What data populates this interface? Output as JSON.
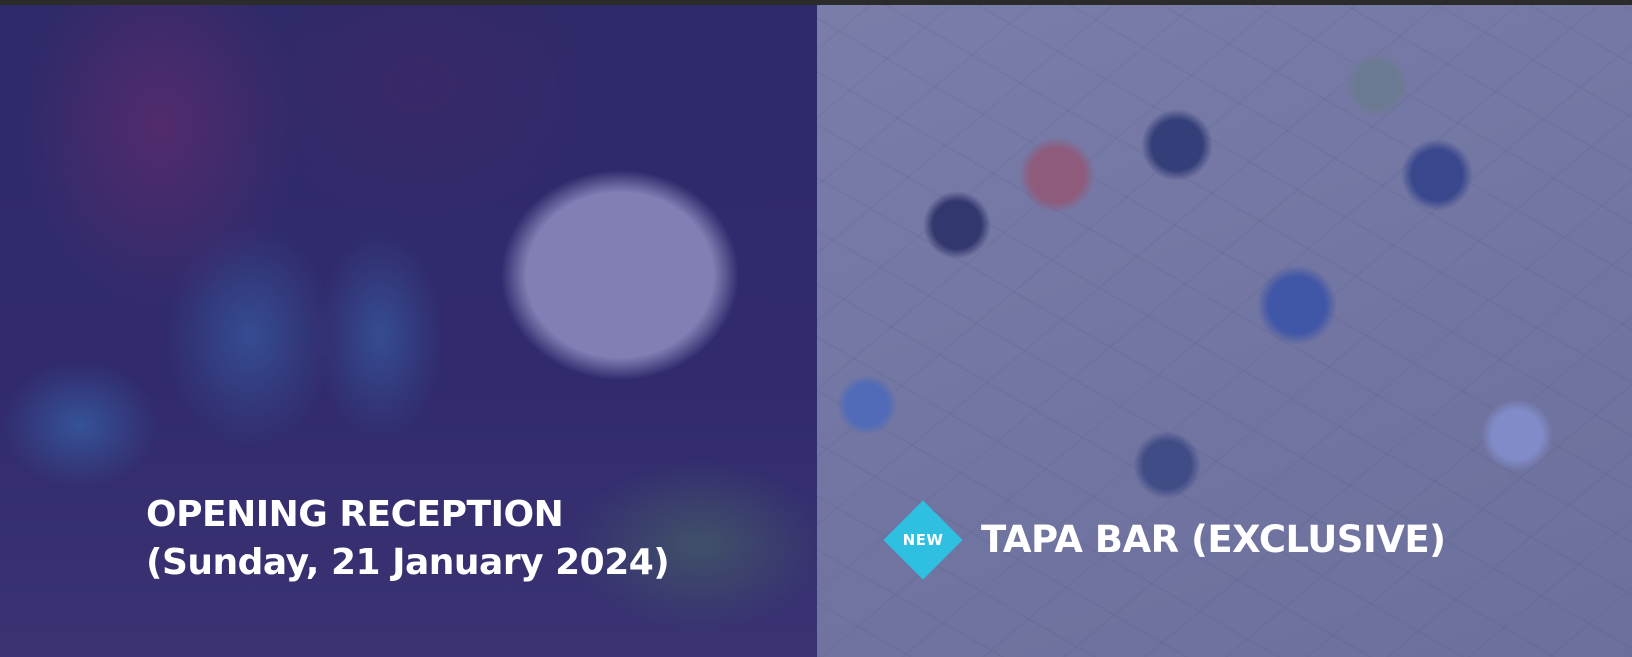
{
  "panels": {
    "opening_reception": {
      "title_line1": "OPENING RECEPTION",
      "title_line2": "(Sunday, 21 January 2024)",
      "image_description_icon": "fire-dancer-photo"
    },
    "tapa_bar": {
      "badge": "NEW",
      "title": "TAPA BAR (EXCLUSIVE)",
      "image_description_icon": "patio-crowd-photo"
    }
  },
  "colors": {
    "overlay_left": "#3a378c",
    "overlay_right": "#464ea5",
    "badge": "#2fbfe0",
    "text": "#ffffff"
  }
}
